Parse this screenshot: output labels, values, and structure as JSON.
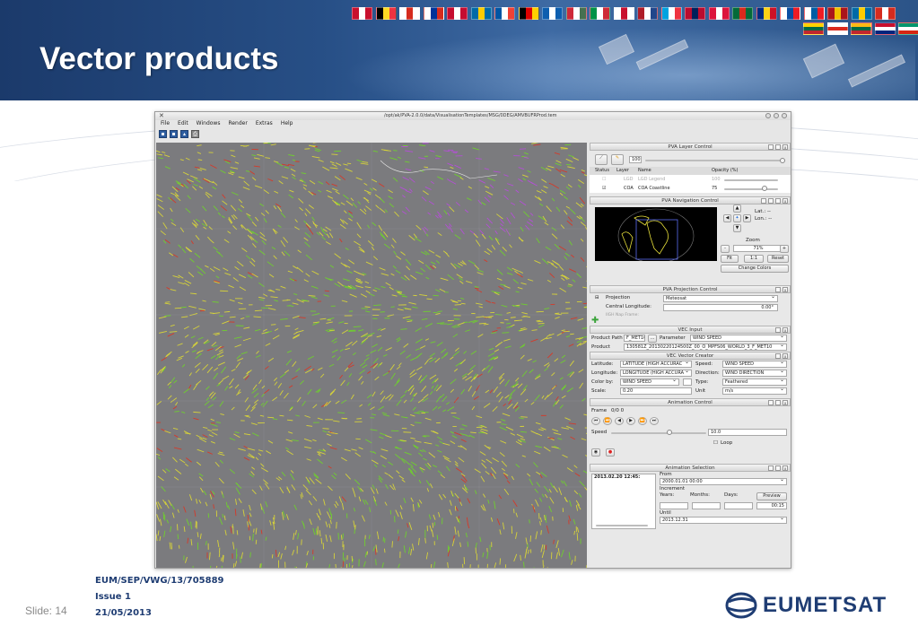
{
  "slide": {
    "title": "Vector products",
    "slide_label": "Slide: 14",
    "doc_ref": "EUM/SEP/VWG/13/705889",
    "issue": "Issue 1",
    "date": "21/05/2013",
    "logo_text": "EUMETSAT"
  },
  "colors": {
    "header_blue": "#274f86",
    "footer_blue": "#1f3d73",
    "map_gray": "#7b7b7e",
    "arrow_yellow": "#d6d23a",
    "arrow_green": "#6fcf2e",
    "arrow_red": "#d43a2a",
    "arrow_magenta": "#b44fd6"
  },
  "window": {
    "title": "/opt/ak/PVA-2.0.0/data/VisualisationTemplates/MSG/0DEG/AMVBUFRProd.tem",
    "menu": [
      "File",
      "Edit",
      "Windows",
      "Render",
      "Extras",
      "Help"
    ],
    "toolbar_icons": [
      "save-icon",
      "save-as-icon",
      "export-icon",
      "print-icon"
    ]
  },
  "layer_control": {
    "title": "PVA Layer Control",
    "opacity_value": "100",
    "columns": [
      "Status",
      "Layer",
      "Name",
      "Opacity (%)"
    ],
    "rows": [
      {
        "layer": "LGD",
        "name": "LGD Legend",
        "opacity": "100"
      },
      {
        "layer": "COA",
        "name": "COA Coastline",
        "opacity": "75"
      }
    ]
  },
  "navigation_control": {
    "title": "PVA Navigation Control",
    "lat_label": "Lat.: --",
    "lon_label": "Lon.: --",
    "zoom_label": "Zoom",
    "zoom_value": "71%",
    "fit_label": "Fit",
    "one_one_label": "1:1",
    "reset_label": "Reset",
    "change_colors_label": "Change Colors"
  },
  "projection_control": {
    "title": "PVA Projection Control",
    "projection_label": "Projection",
    "projection_value": "Meteosat",
    "central_lon_label": "Central Longitude:",
    "central_lon_value": "0.00°",
    "hidden_label": "IIGH Nap Frame:"
  },
  "vec_input": {
    "title": "VEC Input",
    "product_path_label": "Product Path",
    "product_path_value": "F_MET10",
    "browse_label": "...",
    "parameter_label": "Parameter",
    "parameter_value": "WIND SPEED",
    "product_label": "Product",
    "product_value": "130581Z_20130220124500Z_00_O_MPFS06_WORLD_3_F_MET10"
  },
  "vec_vector_creator": {
    "title": "VEC Vector Creator",
    "latitude_label": "Latitude:",
    "latitude_value": "LATITUDE (HIGH ACCURAC",
    "speed_label": "Speed:",
    "speed_value": "WIND SPEED",
    "longitude_label": "Longitude:",
    "longitude_value": "LONGITUDE (HIGH ACCURA",
    "direction_label": "Direction:",
    "direction_value": "WIND DIRECTION",
    "colorby_label": "Color by:",
    "colorby_value": "WIND SPEED",
    "type_label": "Type:",
    "type_value": "Feathered",
    "scale_label": "Scale:",
    "scale_value": "0.20",
    "unit_label": "Unit",
    "unit_value": "m/s"
  },
  "animation_control": {
    "title": "Animation Control",
    "frame_label": "Frame",
    "frame_value": "0/0 0",
    "speed_label": "Speed",
    "speed_value": "10.0",
    "loop_label": "Loop"
  },
  "animation_selection": {
    "title": "Animation Selection",
    "list_item": "2013.02.20 12:45:",
    "from_label": "From",
    "from_value": "2000.01.01 00:00",
    "increment_label": "Increment",
    "years_label": "Years:",
    "months_label": "Months:",
    "days_label": "Days:",
    "preview_label": "Preview",
    "time_value": "00:15",
    "until_label": "Until",
    "until_value": "2013.12.31"
  }
}
